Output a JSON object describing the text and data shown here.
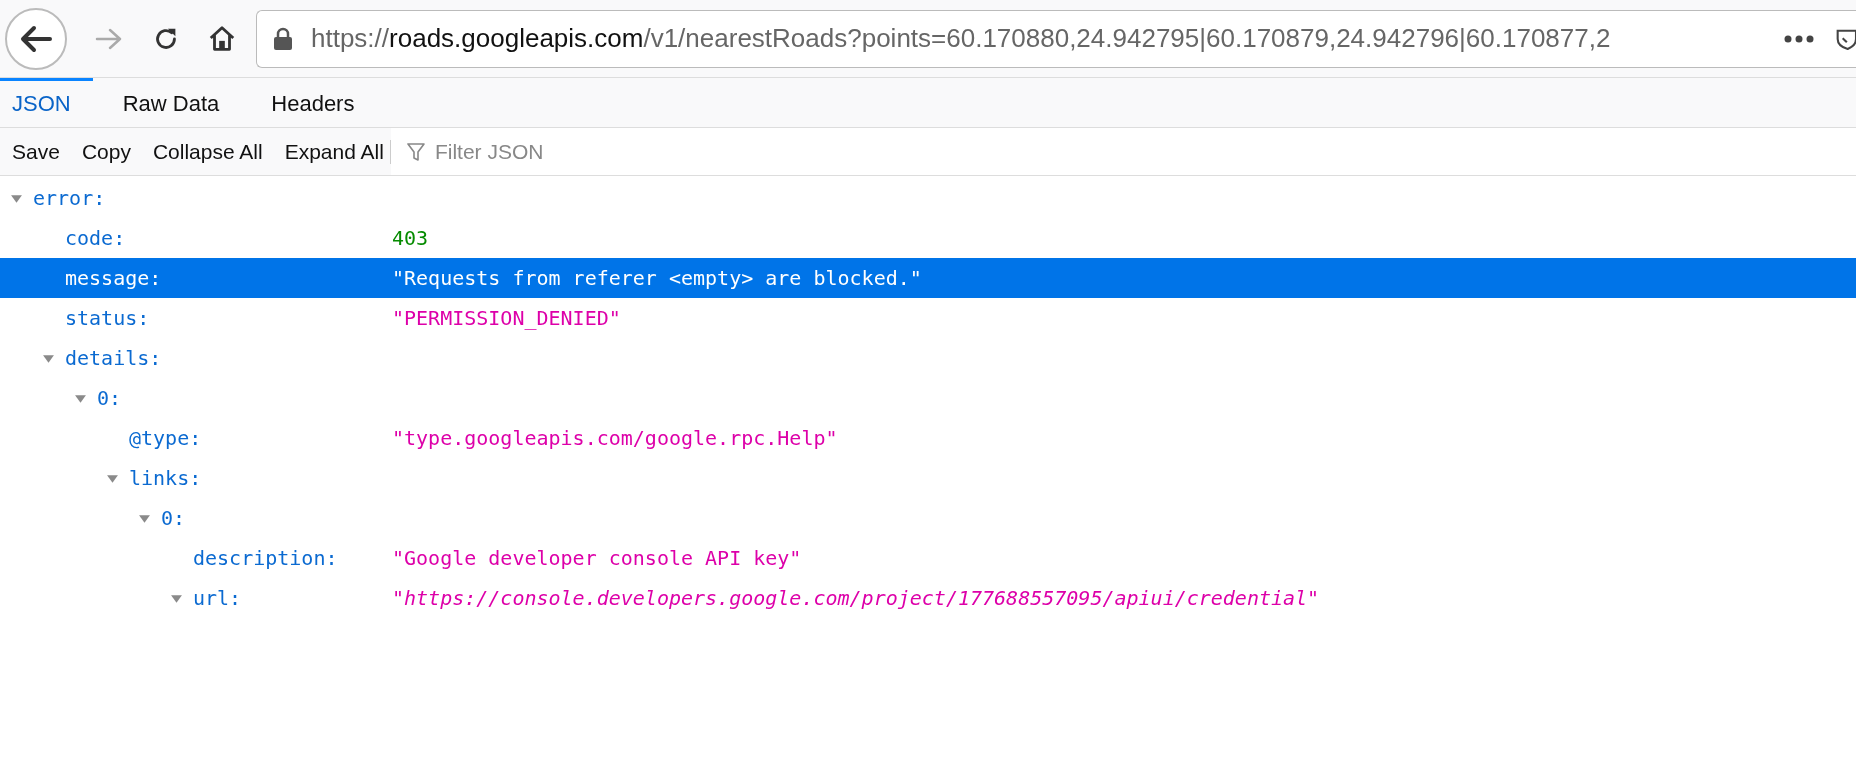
{
  "address_bar": {
    "scheme": "https://",
    "host": "roads.googleapis.com",
    "rest": "/v1/nearestRoads?points=60.170880,24.942795|60.170879,24.942796|60.170877,2"
  },
  "tabs": [
    {
      "label": "JSON",
      "selected": true
    },
    {
      "label": "Raw Data",
      "selected": false
    },
    {
      "label": "Headers",
      "selected": false
    }
  ],
  "toolbar": {
    "buttons": [
      "Save",
      "Copy",
      "Collapse All",
      "Expand All"
    ],
    "filter": {
      "placeholder": "Filter JSON"
    }
  },
  "tree": [
    {
      "key": "error:",
      "expanded": true,
      "selected": false,
      "children": [
        {
          "key": "code:",
          "value": "403",
          "kind": "number",
          "selected": false
        },
        {
          "key": "message:",
          "value": "\"Requests from referer <empty> are blocked.\"",
          "kind": "string",
          "selected": true
        },
        {
          "key": "status:",
          "value": "\"PERMISSION_DENIED\"",
          "kind": "string",
          "selected": false
        },
        {
          "key": "details:",
          "expanded": true,
          "selected": false,
          "children": [
            {
              "key": "0:",
              "expanded": true,
              "selected": false,
              "children": [
                {
                  "key": "@type:",
                  "value": "\"type.googleapis.com/google.rpc.Help\"",
                  "kind": "string",
                  "selected": false
                },
                {
                  "key": "links:",
                  "expanded": true,
                  "selected": false,
                  "children": [
                    {
                      "key": "0:",
                      "expanded": true,
                      "selected": false,
                      "children": [
                        {
                          "key": "description:",
                          "value": "\"Google developer console API key\"",
                          "kind": "string",
                          "selected": false
                        },
                        {
                          "key": "url:",
                          "value": "\"https://console.developers.google.com/project/177688557095/apiui/credential\"",
                          "kind": "link",
                          "expanded": true,
                          "selected": false
                        }
                      ]
                    }
                  ]
                }
              ]
            }
          ]
        }
      ]
    }
  ]
}
